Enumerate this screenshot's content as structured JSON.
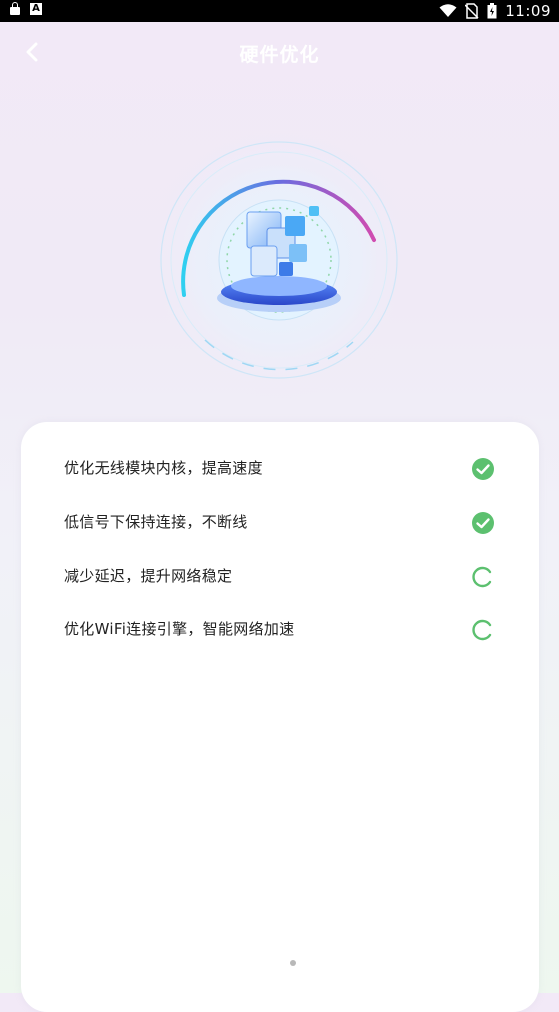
{
  "status_bar": {
    "time": "11:09",
    "left_icons": [
      "lock-icon",
      "a-icon"
    ],
    "right_icons": [
      "wifi-icon",
      "no-sim-icon",
      "battery-icon"
    ]
  },
  "header": {
    "title": "硬件优化",
    "back_icon": "chevron-left-icon"
  },
  "hero": {
    "image": "hardware-chip-illustration",
    "accent_colors": [
      "#3fb8f0",
      "#c44bb8",
      "#4d7cf5"
    ]
  },
  "optimizations": [
    {
      "label": "优化无线模块内核，提高速度",
      "status": "done"
    },
    {
      "label": "低信号下保持连接，不断线",
      "status": "done"
    },
    {
      "label": "减少延迟，提升网络稳定",
      "status": "loading"
    },
    {
      "label": "优化WiFi连接引擎，智能网络加速",
      "status": "loading"
    }
  ],
  "colors": {
    "done": "#5cc06f",
    "loading": "#5cc06f"
  }
}
